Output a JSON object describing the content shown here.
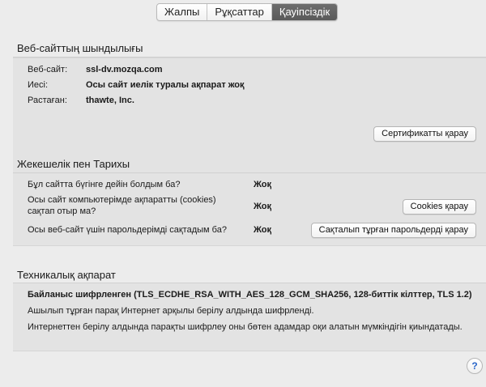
{
  "tabs": [
    {
      "label": "Жалпы",
      "active": false
    },
    {
      "label": "Рұқсаттар",
      "active": false
    },
    {
      "label": "Қауіпсіздік",
      "active": true
    }
  ],
  "website_identity": {
    "title": "Веб-сайттың шындылығы",
    "rows": [
      {
        "label": "Веб-сайт:",
        "value": "ssl-dv.mozqa.com"
      },
      {
        "label": "Иесі:",
        "value": "Осы сайт иелік туралы ақпарат жоқ"
      },
      {
        "label": "Растаған:",
        "value": "thawte, Inc."
      }
    ],
    "button": "Сертификатты қарау"
  },
  "privacy_history": {
    "title": "Жекешелік пен Тарихы",
    "rows": [
      {
        "question": "Бұл сайтта бүгінге дейін болдым ба?",
        "answer": "Жоқ"
      },
      {
        "question_line1": "Осы сайт компьютерімде ақпаратты (cookies)",
        "question_line2": "сақтап отыр ма?",
        "answer": "Жоқ",
        "button": "Cookies қарау"
      },
      {
        "question": "Осы веб-сайт үшін парольдерімді сақтадым ба?",
        "answer": "Жоқ",
        "button": "Сақталып тұрған парольдерді қарау"
      }
    ]
  },
  "technical": {
    "title": "Техникалық ақпарат",
    "line1": "Байланыс шифрленген (TLS_ECDHE_RSA_WITH_AES_128_GCM_SHA256, 128-биттік кілттер, TLS 1.2)",
    "line2": "Ашылып тұрған парақ Интернет арқылы берілу алдында шифрленді.",
    "line3": "Интернеттен берілу алдында парақты шифрлеу оны бөтен адамдар оқи алатын мүмкіндігін қиындатады."
  },
  "help": {
    "symbol": "?"
  }
}
